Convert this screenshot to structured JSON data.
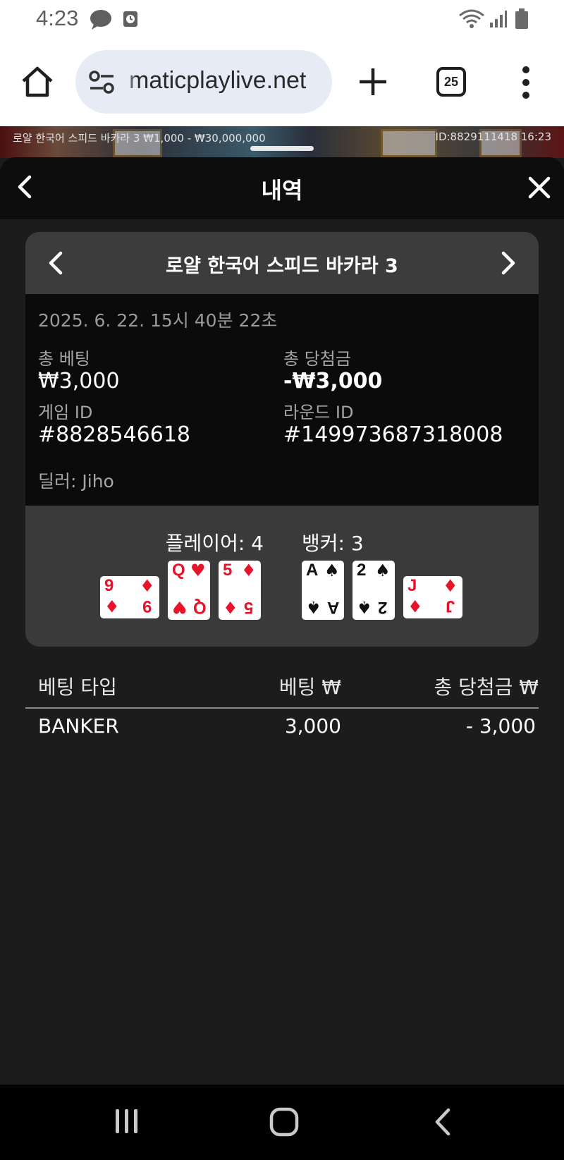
{
  "status_bar": {
    "time": "4:23",
    "icons": [
      "chat-bubble-icon",
      "alarm-icon",
      "wifi-icon",
      "signal-icon",
      "battery-icon"
    ]
  },
  "browser": {
    "url": "maticplaylive.net",
    "tab_count": "25",
    "icons": [
      "home-icon",
      "site-settings-icon",
      "plus-icon",
      "tabs-icon",
      "more-icon"
    ]
  },
  "game_strip": {
    "left_text": "로얄 한국어 스피드 바카라 3   ₩1,000 - ₩30,000,000",
    "right_text": "ID:8829111418   16:23"
  },
  "sheet": {
    "title": "내역"
  },
  "record": {
    "table_name": "로얄 한국어 스피드 바카라 3",
    "datetime": "2025. 6. 22. 15시 40분 22초",
    "total_bet_label": "총 베팅",
    "total_bet_value": "₩3,000",
    "total_win_label": "총 당첨금",
    "total_win_value": "-₩3,000",
    "game_id_label": "게임 ID",
    "game_id_value": "#8828546618",
    "round_id_label": "라운드 ID",
    "round_id_value": "#149973687318008",
    "dealer": "딜러: Jiho"
  },
  "result": {
    "player_label": "플레이어: 4",
    "banker_label": "뱅커: 3",
    "player_cards": [
      {
        "rank": "9",
        "suit": "♦",
        "color": "#e8132a",
        "rotated": true
      },
      {
        "rank": "Q",
        "suit": "♥",
        "color": "#e8132a",
        "rotated": false
      },
      {
        "rank": "5",
        "suit": "♦",
        "color": "#e8132a",
        "rotated": false
      }
    ],
    "banker_cards": [
      {
        "rank": "A",
        "suit": "♠",
        "color": "#111111",
        "rotated": false
      },
      {
        "rank": "2",
        "suit": "♠",
        "color": "#111111",
        "rotated": false
      },
      {
        "rank": "J",
        "suit": "♦",
        "color": "#e8132a",
        "rotated": true
      }
    ]
  },
  "bets": {
    "headers": [
      "베팅 타입",
      "베팅 ₩",
      "총 당첨금 ₩"
    ],
    "rows": [
      {
        "type": "BANKER",
        "bet": "3,000",
        "win": "- 3,000"
      }
    ]
  },
  "nav_bar": {
    "icons": [
      "recent-apps-icon",
      "home-circle-icon",
      "back-icon"
    ]
  }
}
